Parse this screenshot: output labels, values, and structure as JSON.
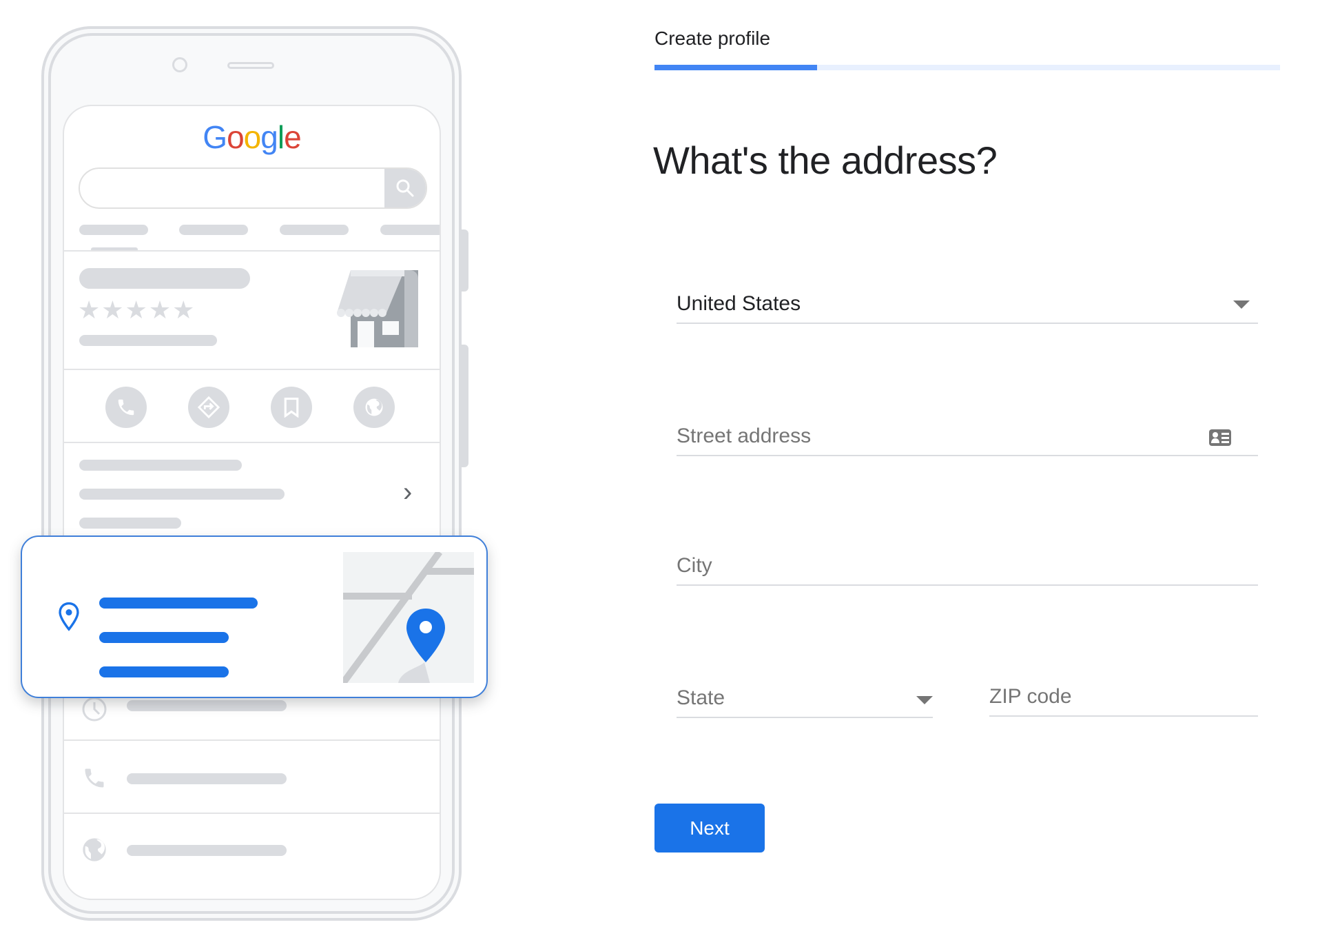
{
  "illustration": {
    "logo_letters": [
      {
        "ch": "G",
        "color": "blue"
      },
      {
        "ch": "o",
        "color": "red"
      },
      {
        "ch": "o",
        "color": "yellow"
      },
      {
        "ch": "g",
        "color": "blue"
      },
      {
        "ch": "l",
        "color": "green"
      },
      {
        "ch": "e",
        "color": "red"
      }
    ],
    "rating_stars": "★★★★★",
    "chevron": "›"
  },
  "step": {
    "title": "Create profile",
    "progress_percent": 26
  },
  "form": {
    "heading": "What's the address?",
    "country": {
      "value": "United States"
    },
    "street": {
      "placeholder": "Street address"
    },
    "city": {
      "placeholder": "City"
    },
    "state": {
      "placeholder": "State"
    },
    "zip": {
      "placeholder": "ZIP code"
    },
    "next_label": "Next"
  },
  "colors": {
    "accent": "#1a73e8",
    "progress_fill": "#4285f4",
    "progress_track": "#e8f0fe"
  }
}
